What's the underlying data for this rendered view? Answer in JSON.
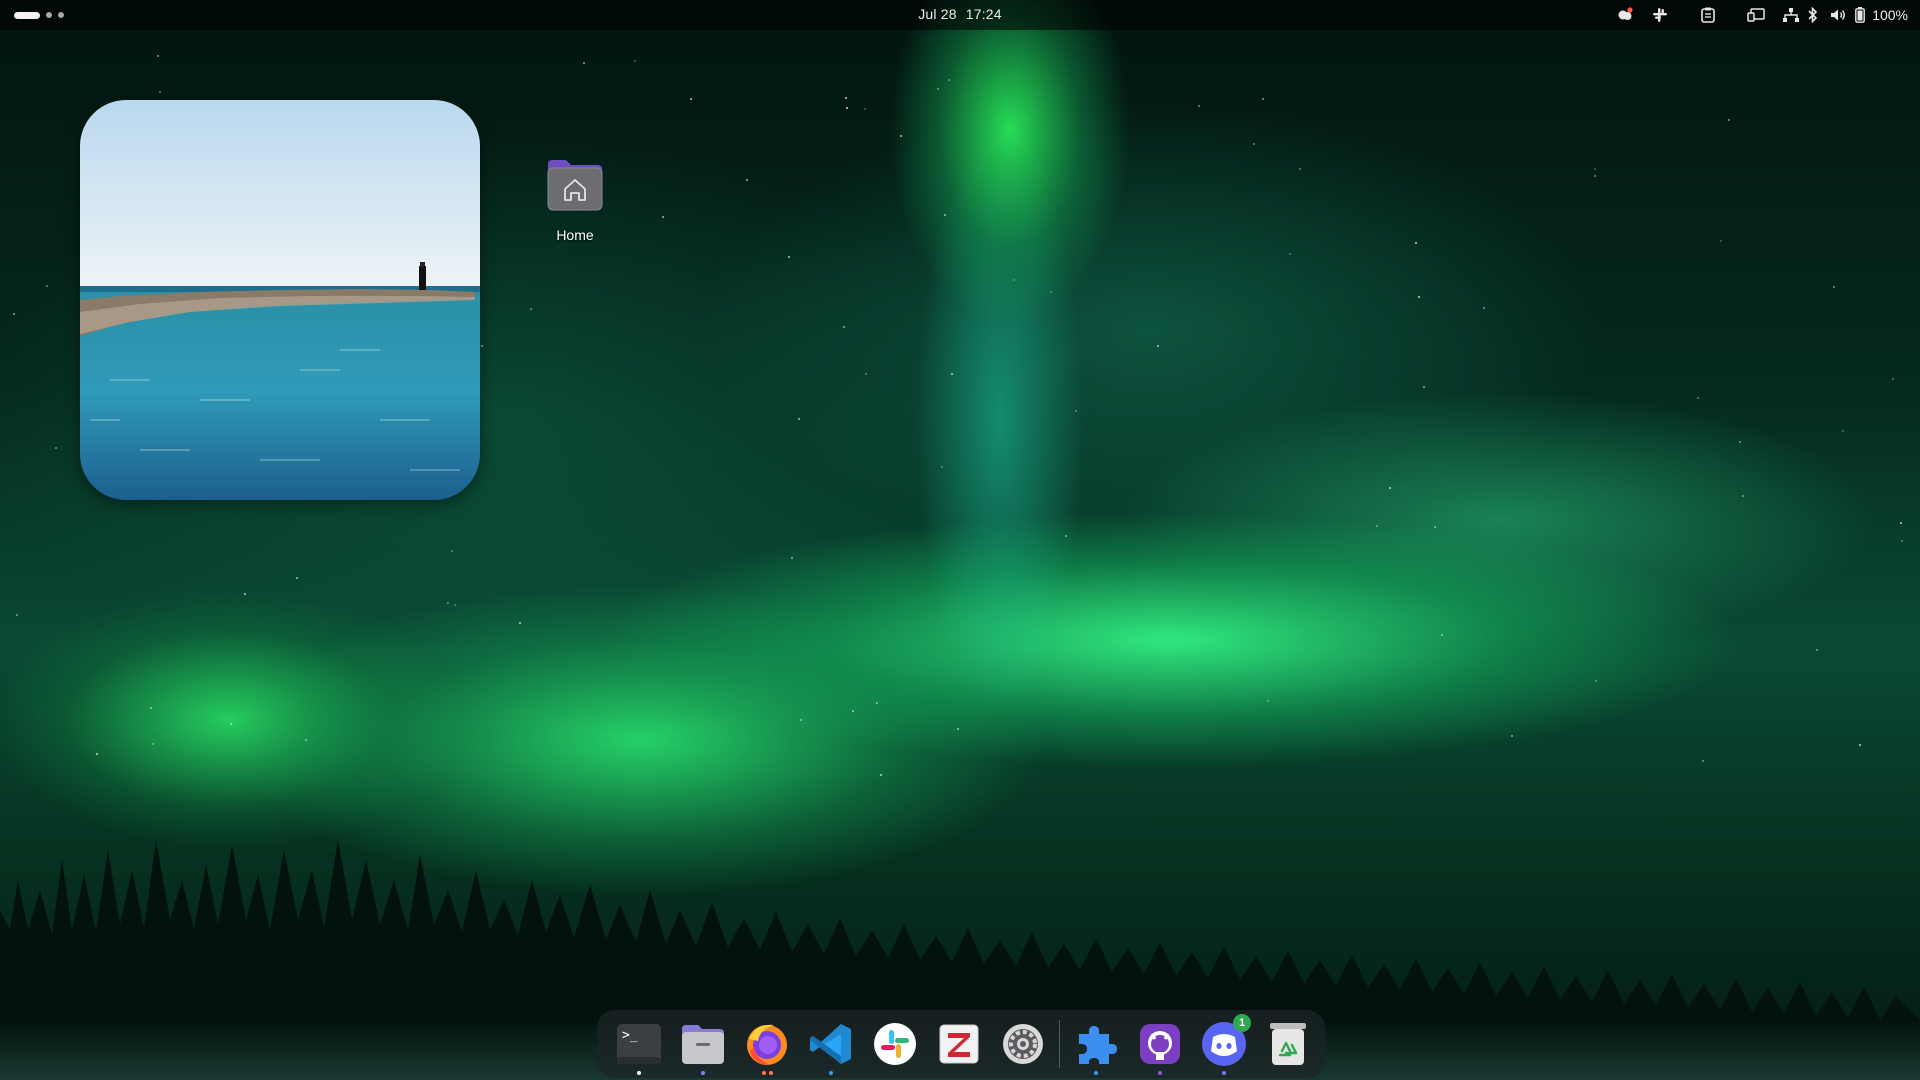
{
  "topbar": {
    "workspace_indicator_icon": "workspace-dots-icon",
    "date": "Jul 28",
    "time": "17:24",
    "tray": {
      "icons": [
        "notification-bell-icon",
        "slack-tray-icon",
        "clipboard-icon",
        "screen-cast-icon",
        "network-icon",
        "bluetooth-icon",
        "volume-icon",
        "battery-icon"
      ],
      "battery_percent": "100%"
    }
  },
  "widget": {
    "type": "photo-frame",
    "subject": "seaside-breakwater-photo"
  },
  "desktop": {
    "icons": [
      {
        "label": "Home",
        "icon": "home-folder-icon"
      }
    ]
  },
  "dock": {
    "apps": [
      {
        "name": "terminal",
        "icon": "terminal-icon",
        "running_dots": [
          "#ffffff"
        ]
      },
      {
        "name": "files",
        "icon": "files-icon",
        "running_dots": [
          "#8a7bff"
        ]
      },
      {
        "name": "firefox",
        "icon": "firefox-icon",
        "running_dots": [
          "#ff7a45",
          "#ff7a45"
        ]
      },
      {
        "name": "vscode",
        "icon": "vscode-icon",
        "running_dots": [
          "#3b9be6"
        ]
      },
      {
        "name": "slack",
        "icon": "slack-icon",
        "running_dots": []
      },
      {
        "name": "zotero",
        "icon": "zotero-icon",
        "running_dots": []
      },
      {
        "name": "settings",
        "icon": "settings-icon",
        "running_dots": []
      },
      {
        "name": "extensions",
        "icon": "extensions-icon",
        "running_dots": [
          "#3b9be6"
        ]
      },
      {
        "name": "github-desktop",
        "icon": "github-icon",
        "running_dots": [
          "#9b59d0"
        ]
      },
      {
        "name": "discord",
        "icon": "discord-icon",
        "running_dots": [
          "#6c7cff"
        ],
        "badge": "1"
      },
      {
        "name": "trash",
        "icon": "trash-icon",
        "running_dots": []
      }
    ]
  },
  "colors": {
    "topbar_text": "#ededed",
    "dock_bg": "#1c2426",
    "accent_green": "#2fa84f"
  }
}
